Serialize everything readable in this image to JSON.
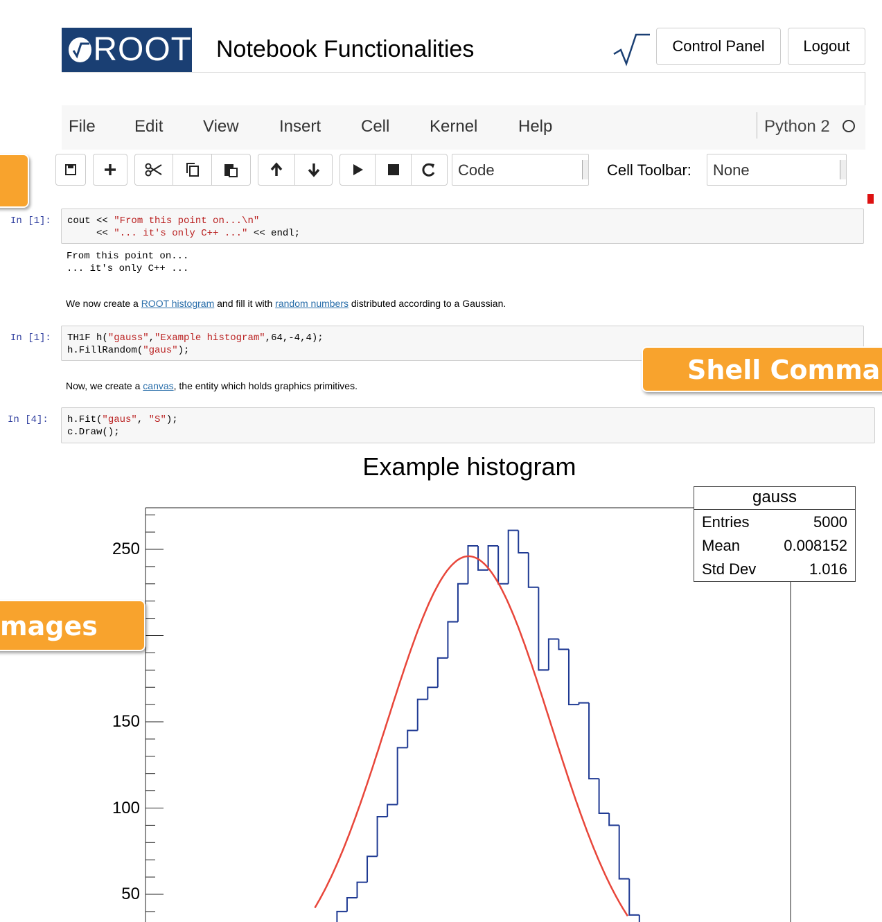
{
  "header": {
    "logo_text": "ROOT",
    "notebook_title": "Notebook Functionalities",
    "control_panel_label": "Control Panel",
    "logout_label": "Logout",
    "icon": "sqrt-icon"
  },
  "menubar": {
    "items": [
      {
        "label": "File"
      },
      {
        "label": "Edit"
      },
      {
        "label": "View"
      },
      {
        "label": "Insert"
      },
      {
        "label": "Cell"
      },
      {
        "label": "Kernel"
      },
      {
        "label": "Help"
      }
    ],
    "kernel_name": "Python 2"
  },
  "toolbar": {
    "icons": [
      "save-icon",
      "plus-icon",
      "scissors-icon",
      "copy-icon",
      "paste-icon",
      "arrow-up-icon",
      "arrow-down-icon",
      "play-icon",
      "stop-icon",
      "restart-icon"
    ],
    "cell_type": "Code",
    "cell_toolbar_label": "Cell Toolbar:",
    "cell_toolbar_value": "None"
  },
  "overlay_tags": {
    "shell": "Shell Comma",
    "images": "mages"
  },
  "cells": {
    "c1": {
      "prompt": "In [1]:",
      "code_lines": [
        {
          "a": "cout << ",
          "s": "\"From this point on...\\n\"",
          "b": ""
        },
        {
          "a": "     << ",
          "s": "\"... it's only C++ ...\"",
          "b": " << endl;"
        }
      ],
      "output": "From this point on...\n... it's only C++ ..."
    },
    "md1": {
      "pre": "We now create a ",
      "link1": "ROOT histogram",
      "mid": " and fill it with ",
      "link2": "random numbers",
      "post": " distributed according to a Gaussian."
    },
    "c2": {
      "prompt": "In [1]:",
      "line1": {
        "a": "TH1F h(",
        "s1": "\"gauss\"",
        "c": ",",
        "s2": "\"Example histogram\"",
        "b": ",64,-4,4);"
      },
      "line2": {
        "a": "h.FillRandom(",
        "s": "\"gaus\"",
        "b": ");"
      }
    },
    "md2": {
      "pre": "Now, we create a ",
      "link": "canvas",
      "post": ", the entity which holds graphics primitives."
    },
    "c3": {
      "prompt": "In [4]:",
      "line1": {
        "a": "h.Fit(",
        "s1": "\"gaus\"",
        "c": ", ",
        "s2": "\"S\"",
        "b": ");"
      },
      "line2": "c.Draw();"
    }
  },
  "chart_data": {
    "type": "bar",
    "title": "Example histogram",
    "bin_width": 0.125,
    "x_range": [
      -4,
      4
    ],
    "ylim_visible": [
      35,
      275
    ],
    "ytick_labels": [
      "250",
      "150",
      "100",
      "50"
    ],
    "ytick_values": [
      250,
      150,
      100,
      50
    ],
    "hist_bins": [
      {
        "x": -1.625,
        "y": 40
      },
      {
        "x": -1.5,
        "y": 48
      },
      {
        "x": -1.375,
        "y": 57
      },
      {
        "x": -1.25,
        "y": 72
      },
      {
        "x": -1.125,
        "y": 95
      },
      {
        "x": -1.0,
        "y": 102
      },
      {
        "x": -0.875,
        "y": 135
      },
      {
        "x": -0.75,
        "y": 145
      },
      {
        "x": -0.625,
        "y": 163
      },
      {
        "x": -0.5,
        "y": 170
      },
      {
        "x": -0.375,
        "y": 187
      },
      {
        "x": -0.25,
        "y": 208
      },
      {
        "x": -0.125,
        "y": 230
      },
      {
        "x": 0.0,
        "y": 252
      },
      {
        "x": 0.125,
        "y": 238
      },
      {
        "x": 0.25,
        "y": 252
      },
      {
        "x": 0.375,
        "y": 230
      },
      {
        "x": 0.5,
        "y": 261
      },
      {
        "x": 0.625,
        "y": 248
      },
      {
        "x": 0.75,
        "y": 228
      },
      {
        "x": 0.875,
        "y": 180
      },
      {
        "x": 1.0,
        "y": 198
      },
      {
        "x": 1.125,
        "y": 192
      },
      {
        "x": 1.25,
        "y": 160
      },
      {
        "x": 1.375,
        "y": 161
      },
      {
        "x": 1.5,
        "y": 117
      },
      {
        "x": 1.625,
        "y": 97
      },
      {
        "x": 1.75,
        "y": 90
      },
      {
        "x": 1.875,
        "y": 59
      },
      {
        "x": 2.0,
        "y": 38
      }
    ],
    "fit": {
      "type": "gaus",
      "constant": 246,
      "mean": 0.008152,
      "sigma": 1.016
    },
    "stats": {
      "name": "gauss",
      "rows": [
        {
          "label": "Entries",
          "value": "5000"
        },
        {
          "label": "Mean",
          "value": "0.008152"
        },
        {
          "label": "Std Dev",
          "value": "1.016"
        }
      ]
    },
    "colors": {
      "histogram": "#1f3a93",
      "fit": "#e8463a",
      "axis": "#222222"
    }
  }
}
